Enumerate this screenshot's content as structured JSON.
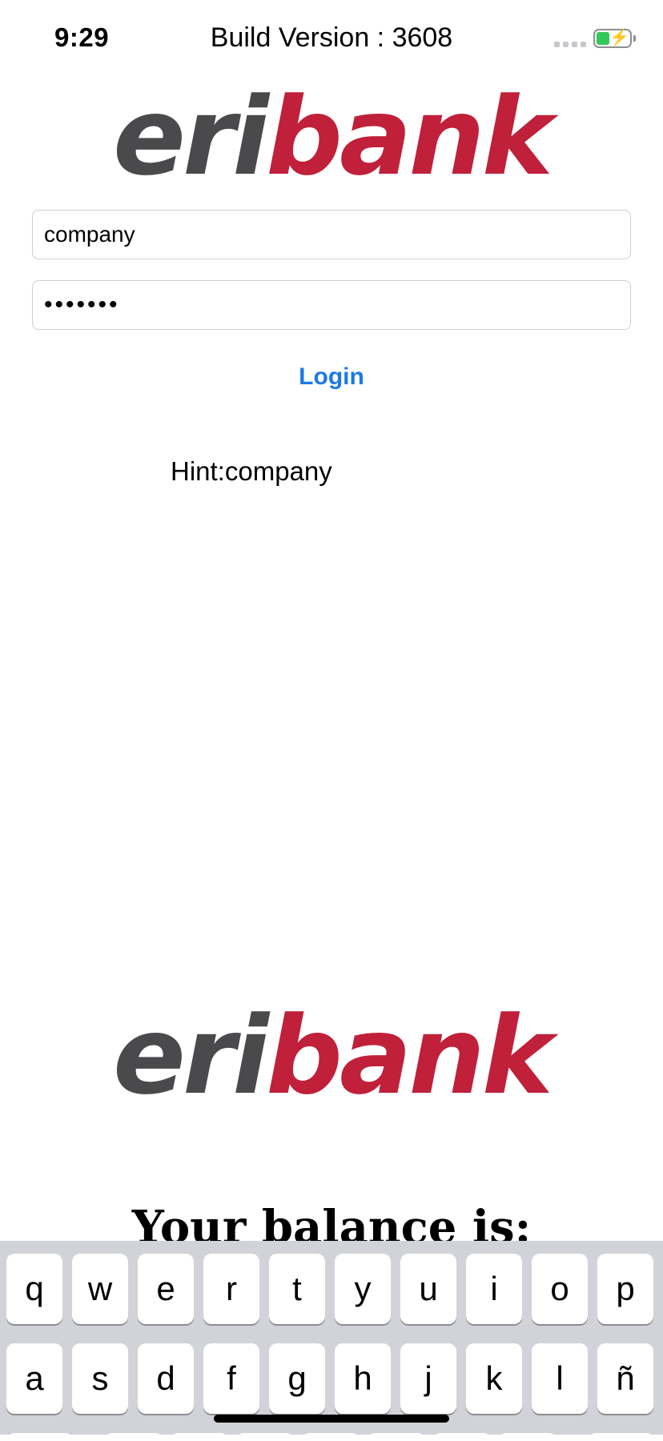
{
  "status_bar": {
    "time": "9:29",
    "build_version": "Build Version : 3608"
  },
  "logo": {
    "part1": "eri",
    "part2": "bank"
  },
  "form": {
    "username_value": "company",
    "password_value": "•••••••",
    "login_label": "Login"
  },
  "hint": "Hint:company",
  "balance_heading": "Your balance is:",
  "keyboard": {
    "row1": [
      "q",
      "w",
      "e",
      "r",
      "t",
      "y",
      "u",
      "i",
      "o",
      "p"
    ],
    "row2": [
      "a",
      "s",
      "d",
      "f",
      "g",
      "h",
      "j",
      "k",
      "l",
      "ñ"
    ]
  },
  "colors": {
    "brand_gray": "#4a4a4c",
    "brand_red": "#c0203a",
    "link_blue": "#1a7ae6",
    "battery_green": "#34c759"
  }
}
